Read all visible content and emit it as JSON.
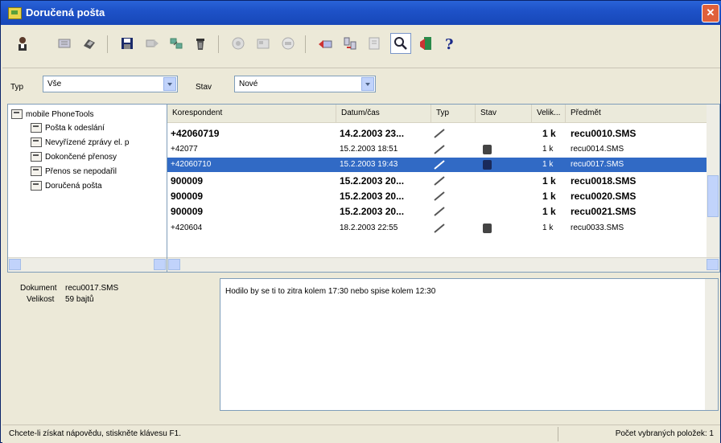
{
  "window": {
    "title": "Doručená pošta"
  },
  "toolbar": {
    "buttons": [
      {
        "icon": "contact-icon"
      },
      {
        "icon": "sms-icon"
      },
      {
        "icon": "fax-icon"
      },
      {
        "icon": "save-icon"
      },
      {
        "icon": "forward-icon"
      },
      {
        "icon": "move-icon"
      },
      {
        "icon": "delete-icon"
      },
      {
        "icon": "phone-icon"
      },
      {
        "icon": "card-icon"
      },
      {
        "icon": "disc-icon"
      },
      {
        "icon": "reply-icon"
      },
      {
        "icon": "transfer-icon"
      },
      {
        "icon": "properties-icon"
      },
      {
        "icon": "search-icon"
      },
      {
        "icon": "exit-icon"
      },
      {
        "icon": "help-icon"
      }
    ]
  },
  "filters": {
    "typ_label": "Typ",
    "typ_value": "Vše",
    "stav_label": "Stav",
    "stav_value": "Nové"
  },
  "tree": {
    "root": "mobile PhoneTools",
    "items": [
      "Pošta k odeslání",
      "Nevyřízené zprávy el. p",
      "Dokončené přenosy",
      "Přenos se nepodařil",
      "Doručená pošta"
    ]
  },
  "list": {
    "columns": {
      "korespondent": "Korespondent",
      "datum": "Datum/čas",
      "typ": "Typ",
      "stav": "Stav",
      "velikost": "Velik...",
      "predmet": "Předmět"
    },
    "rows": [
      {
        "korespondent": "+42060719",
        "datum": "14.2.2003 23...",
        "velikost": "1 k",
        "predmet": "recu0010.SMS"
      },
      {
        "korespondent": "+42077",
        "datum": "15.2.2003 18:51",
        "velikost": "1 k",
        "predmet": "recu0014.SMS"
      },
      {
        "korespondent": "+42060710",
        "datum": "15.2.2003 19:43",
        "velikost": "1 k",
        "predmet": "recu0017.SMS"
      },
      {
        "korespondent": "900009",
        "datum": "15.2.2003 20...",
        "velikost": "1 k",
        "predmet": "recu0018.SMS"
      },
      {
        "korespondent": "900009",
        "datum": "15.2.2003 20...",
        "velikost": "1 k",
        "predmet": "recu0020.SMS"
      },
      {
        "korespondent": "900009",
        "datum": "15.2.2003 20...",
        "velikost": "1 k",
        "predmet": "recu0021.SMS"
      },
      {
        "korespondent": "+420604",
        "datum": "18.2.2003 22:55",
        "velikost": "1 k",
        "predmet": "recu0033.SMS"
      }
    ]
  },
  "details": {
    "dokument_label": "Dokument",
    "dokument_value": "recu0017.SMS",
    "velikost_label": "Velikost",
    "velikost_value": "59 bajtů"
  },
  "preview": {
    "text": "Hodilo by se ti to zitra kolem 17:30 nebo spise kolem 12:30"
  },
  "status": {
    "hint": "Chcete-li získat nápovědu, stiskněte klávesu F1.",
    "selected_count": "Počet vybraných položek: 1"
  },
  "colors": {
    "selection": "#316ac5",
    "titlebar": "#1e52c8"
  }
}
